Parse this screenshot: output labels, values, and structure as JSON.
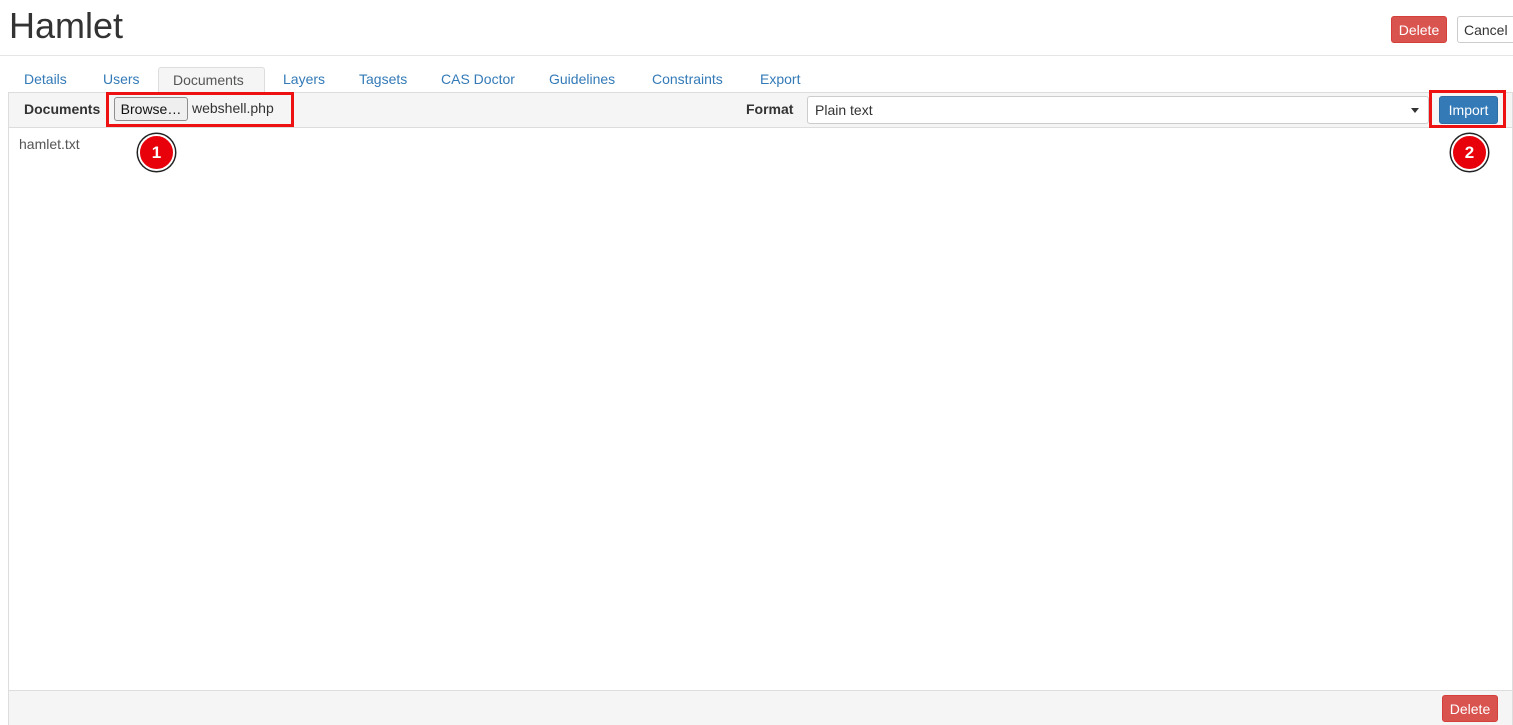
{
  "header": {
    "title": "Hamlet",
    "delete_label": "Delete",
    "cancel_label": "Cancel"
  },
  "tabs": [
    {
      "label": "Details",
      "active": false
    },
    {
      "label": "Users",
      "active": false
    },
    {
      "label": "Documents",
      "active": true
    },
    {
      "label": "Layers",
      "active": false
    },
    {
      "label": "Tagsets",
      "active": false
    },
    {
      "label": "CAS Doctor",
      "active": false
    },
    {
      "label": "Guidelines",
      "active": false
    },
    {
      "label": "Constraints",
      "active": false
    },
    {
      "label": "Export",
      "active": false
    }
  ],
  "toolbar": {
    "documents_label": "Documents",
    "browse_label": "Browse…",
    "selected_file": "webshell.php",
    "format_label": "Format",
    "format_value": "Plain text",
    "import_label": "Import"
  },
  "documents": [
    {
      "name": "hamlet.txt"
    }
  ],
  "footer": {
    "delete_label": "Delete"
  },
  "annotations": {
    "marker_1": "1",
    "marker_2": "2"
  },
  "colors": {
    "danger": "#d9534f",
    "primary": "#337ab7",
    "link": "#337ab7",
    "highlight": "#ee1111"
  }
}
